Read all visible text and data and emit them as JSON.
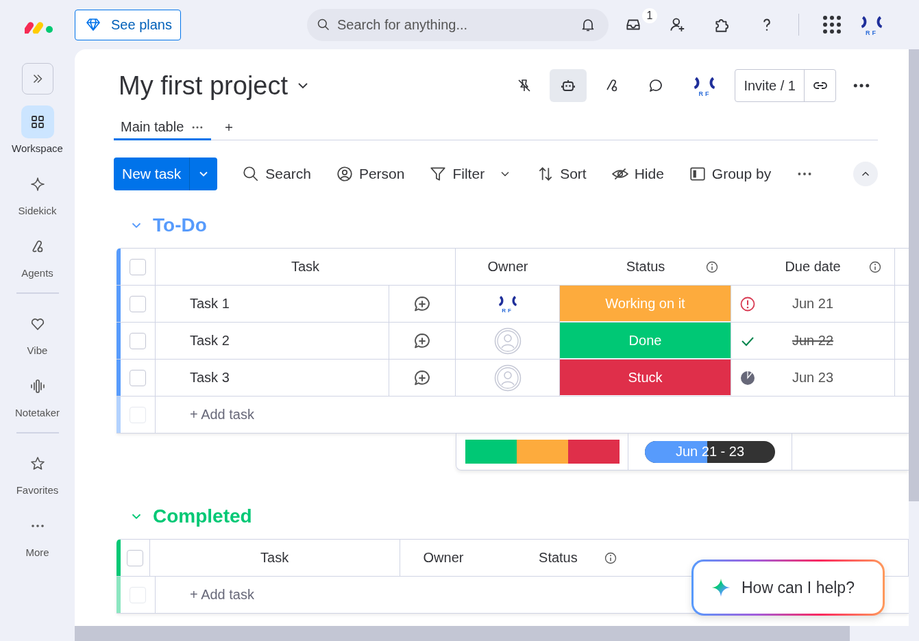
{
  "top_bar": {
    "plans_button": "See plans",
    "search": {
      "placeholder": "Search for anything..."
    },
    "inbox_badge": "1",
    "avatar_label": "RF"
  },
  "sidebar": {
    "sections": [
      [
        {
          "label": "Workspace",
          "selected": true
        },
        {
          "label": "Sidekick",
          "selected": false
        },
        {
          "label": "Agents",
          "selected": false
        }
      ],
      [
        {
          "label": "Vibe",
          "selected": false
        },
        {
          "label": "Notetaker",
          "selected": false
        }
      ],
      [
        {
          "label": "Favorites",
          "selected": false
        },
        {
          "label": "More",
          "selected": false
        }
      ]
    ]
  },
  "board": {
    "title": "My first project",
    "header_tools": [
      {
        "selected": false
      },
      {
        "selected": true
      },
      {
        "selected": false
      },
      {
        "selected": false
      }
    ],
    "avatar_label": "RF",
    "invite_button": "Invite / 1",
    "tabs": [
      {
        "label": "Main table",
        "selected": true
      }
    ],
    "toolbar": {
      "new_button": "New task",
      "items": [
        "Search",
        "Person",
        "Filter",
        "Sort",
        "Hide",
        "Group by"
      ]
    },
    "groups": [
      {
        "title": "To-Do",
        "color": "#579bfc",
        "expanded": true,
        "all_checked": false,
        "columns": [
          "Task",
          "Owner",
          "Status",
          "Due date"
        ],
        "rows": [
          {
            "name": "Task 1",
            "checked": false,
            "owner": {
              "kind": "avatar",
              "label": "RF"
            },
            "status": {
              "label": "Working on it",
              "color": "#fdab3d"
            },
            "due": {
              "date": "Jun 21",
              "kind": "overdue"
            }
          },
          {
            "name": "Task 2",
            "checked": false,
            "owner": {
              "kind": "empty"
            },
            "status": {
              "label": "Done",
              "color": "#00c875"
            },
            "due": {
              "date": "Jun 22",
              "kind": "done"
            }
          },
          {
            "name": "Task 3",
            "checked": false,
            "owner": {
              "kind": "empty"
            },
            "status": {
              "label": "Stuck",
              "color": "#df2f4a"
            },
            "due": {
              "date": "Jun 23",
              "kind": "pending"
            }
          }
        ],
        "add_row": {
          "label": "+ Add task",
          "checked": false
        },
        "summary": {
          "status_segments": [
            {
              "color": "#00c875"
            },
            {
              "color": "#fdab3d"
            },
            {
              "color": "#df2f4a"
            }
          ],
          "date_range": {
            "label": "Jun 21 - 23",
            "level": 0.48
          }
        }
      },
      {
        "title": "Completed",
        "color": "#00c875",
        "expanded": true,
        "all_checked": false,
        "columns": [
          "Task",
          "Owner",
          "Status"
        ],
        "add_row": {
          "label": "+ Add task",
          "checked": false
        }
      }
    ]
  },
  "assistant": {
    "prompt": "How can I help?"
  }
}
